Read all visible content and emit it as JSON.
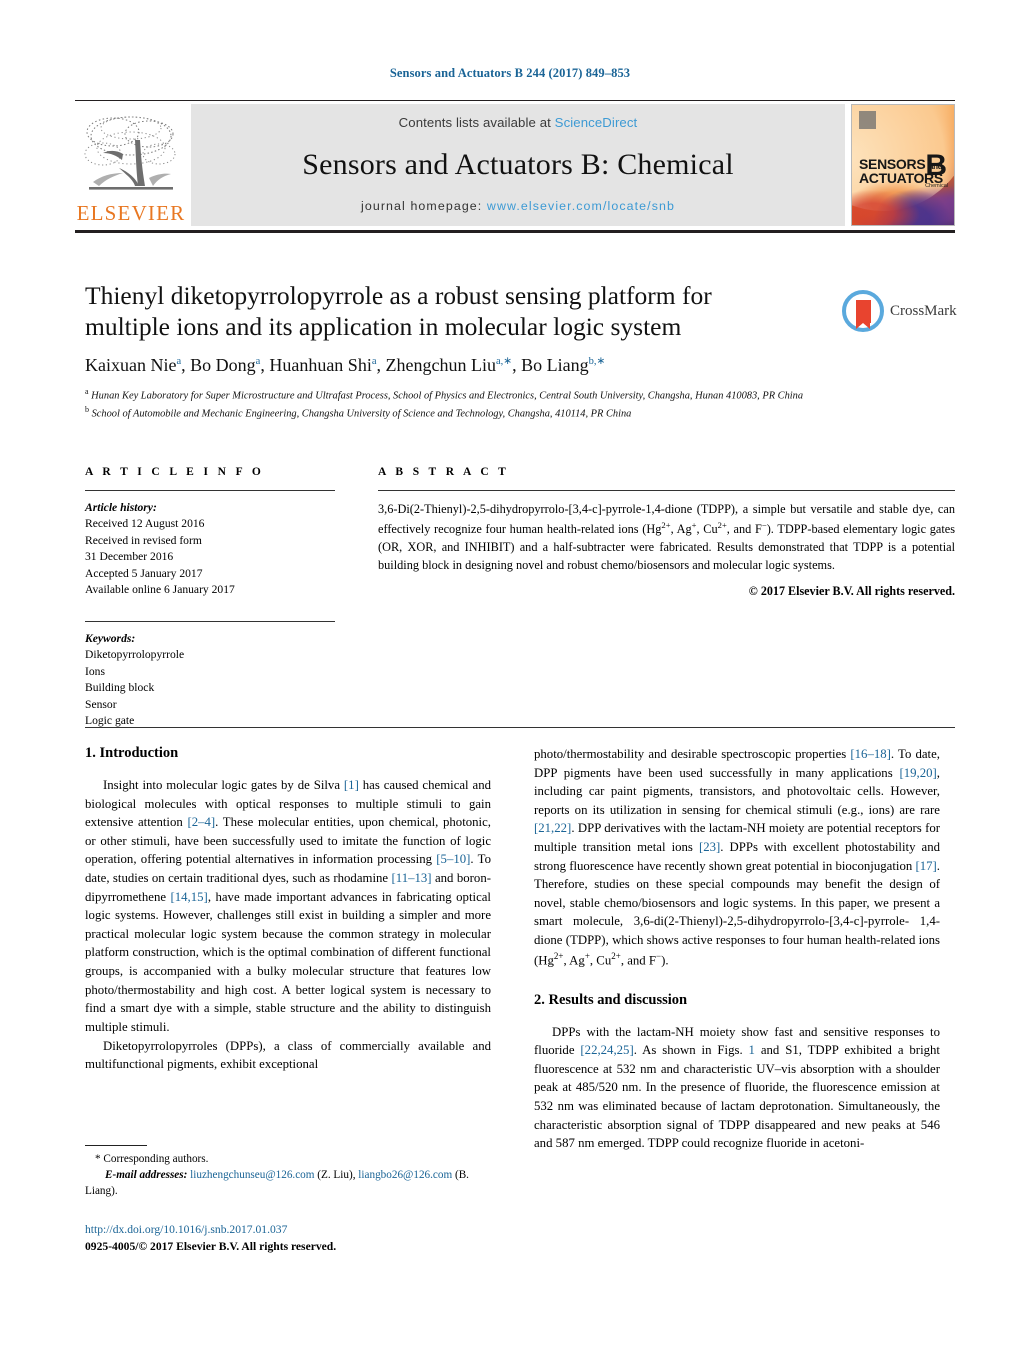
{
  "running_head": "Sensors and Actuators B 244 (2017) 849–853",
  "masthead": {
    "contents_prefix": "Contents lists available at ",
    "sciencedirect": "ScienceDirect",
    "journal_title": "Sensors and Actuators B: Chemical",
    "homepage_label": "journal homepage: ",
    "homepage_url": "www.elsevier.com/locate/snb",
    "publisher_logo_text": "ELSEVIER",
    "cover": {
      "line1": "SENSORS",
      "and": "and",
      "line2": "ACTUATORS",
      "volume_letter": "B",
      "subtitle": "Chemical"
    }
  },
  "crossmark": {
    "label": "CrossMark"
  },
  "article": {
    "title": "Thienyl diketopyrrolopyrrole as a robust sensing platform for multiple ions and its application in molecular logic system",
    "authors_html": "Kaixuan Nie<sup>a</sup>, Bo Dong<sup>a</sup>, Huanhuan Shi<sup>a</sup>, Zhengchun Liu<sup>a,∗</sup>, Bo Liang<sup>b,∗</sup>",
    "affiliations": [
      "Hunan Key Laboratory for Super Microstructure and Ultrafast Process, School of Physics and Electronics, Central South University, Changsha, Hunan 410083, PR China",
      "School of Automobile and Mechanic Engineering, Changsha University of Science and Technology, Changsha, 410114, PR China"
    ],
    "affiliation_marks": [
      "a",
      "b"
    ]
  },
  "article_info": {
    "heading": "A R T I C L E   I N F O",
    "history_label": "Article history:",
    "history": [
      "Received 12 August 2016",
      "Received in revised form",
      "31 December 2016",
      "Accepted 5 January 2017",
      "Available online 6 January 2017"
    ],
    "keywords_label": "Keywords:",
    "keywords": [
      "Diketopyrrolopyrrole",
      "Ions",
      "Building block",
      "Sensor",
      "Logic gate"
    ]
  },
  "abstract": {
    "heading": "A B S T R A C T",
    "body_html": "3,6-Di(2-Thienyl)-2,5-dihydropyrrolo-[3,4-c]-pyrrole-1,4-dione (TDPP), a simple but versatile and stable dye, can effectively recognize four human health-related ions (Hg<sup>2+</sup>, Ag<sup>+</sup>, Cu<sup>2+</sup>, and F<sup>−</sup>). TDPP-based elementary logic gates (OR, XOR, and INHIBIT) and a half-subtracter were fabricated. Results demonstrated that TDPP is a potential building block in designing novel and robust chemo/biosensors and molecular logic systems.",
    "copyright": "© 2017 Elsevier B.V. All rights reserved."
  },
  "sections": {
    "introduction_heading": "1.  Introduction",
    "results_heading": "2.  Results and discussion"
  },
  "body": {
    "intro_p1_html": "Insight into molecular logic gates by de Silva <span class=\"ref\">[1]</span> has caused chemical and biological molecules with optical responses to multiple stimuli to gain extensive attention <span class=\"ref\">[2–4]</span>. These molecular entities, upon chemical, photonic, or other stimuli, have been successfully used to imitate the function of logic operation, offering potential alternatives in information processing <span class=\"ref\">[5–10]</span>. To date, studies on certain traditional dyes, such as rhodamine <span class=\"ref\">[11–13]</span> and boron-dipyrromethene <span class=\"ref\">[14,15]</span>, have made important advances in fabricating optical logic systems. However, challenges still exist in building a simpler and more practical molecular logic system because the common strategy in molecular platform construction, which is the optimal combination of different functional groups, is accompanied with a bulky molecular structure that features low photo/thermostability and high cost. A better logical system is necessary to find a smart dye with a simple, stable structure and the ability to distinguish multiple stimuli.",
    "intro_p2_html": "Diketopyrrolopyrroles (DPPs), a class of commercially available and multifunctional pigments, exhibit exceptional",
    "intro_p3_html": "photo/thermostability and desirable spectroscopic properties <span class=\"ref\">[16–18]</span>. To date, DPP pigments have been used successfully in many applications <span class=\"ref\">[19,20]</span>, including car paint pigments, transistors, and photovoltaic cells. However, reports on its utilization in sensing for chemical stimuli (e.g., ions) are rare <span class=\"ref\">[21,22]</span>. DPP derivatives with the lactam-NH moiety are potential receptors for multiple transition metal ions <span class=\"ref\">[23]</span>. DPPs with excellent photostability and strong fluorescence have recently shown great potential in bioconjugation <span class=\"ref\">[17]</span>. Therefore, studies on these special compounds may benefit the design of novel, stable chemo/biosensors and logic systems. In this paper, we present a smart molecule, 3,6-di(2-Thienyl)-2,5-dihydropyrrolo-[3,4-c]-pyrrole- 1,4-dione (TDPP), which shows active responses to four human health-related ions (Hg<sup>2+</sup>, Ag<sup>+</sup>, Cu<sup>2+</sup>, and F<sup>−</sup>).",
    "results_p1_html": "DPPs with the lactam-NH moiety show fast and sensitive responses to fluoride <span class=\"ref\">[22,24,25]</span>. As shown in Figs. <span class=\"ref\">1</span> and S1, TDPP exhibited a bright fluorescence at 532 nm and characteristic UV–vis absorption with a shoulder peak at 485/520 nm. In the presence of fluoride, the fluorescence emission at 532 nm was eliminated because of lactam deprotonation. Simultaneously, the characteristic absorption signal of TDPP disappeared and new peaks at 546 and 587 nm emerged. TDPP could recognize fluoride in acetoni-"
  },
  "footnote": {
    "corresponding": "* Corresponding authors.",
    "email_label": "E-mail addresses:",
    "email1": "liuzhengchunseu@126.com",
    "email1_owner": "(Z. Liu),",
    "email2": "liangbo26@126.com",
    "email2_owner": "(B. Liang).",
    "doi": "http://dx.doi.org/10.1016/j.snb.2017.01.037",
    "issn_line": "0925-4005/© 2017 Elsevier B.V. All rights reserved."
  },
  "colors": {
    "link": "#1a6496",
    "sciencedirect": "#3d9ad4",
    "elsevier_orange": "#E87722",
    "masthead_bg": "#e4e4e4"
  }
}
